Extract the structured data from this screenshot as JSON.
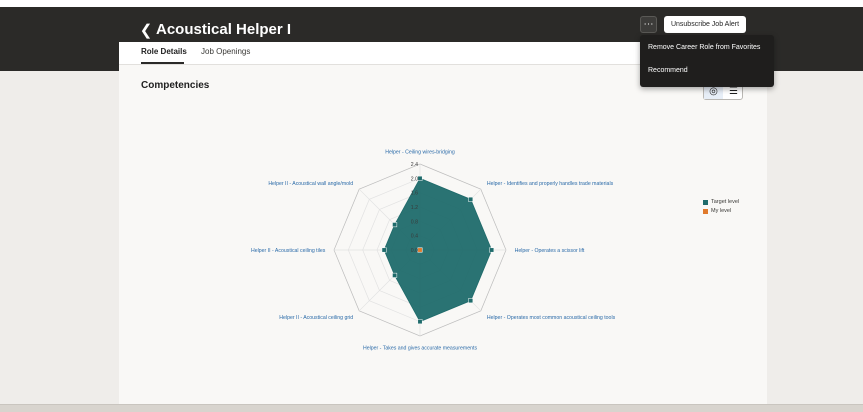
{
  "header": {
    "title": "Acoustical Helper I",
    "back_icon": "chevron-left-icon",
    "more_icon": "ellipsis-icon",
    "unsubscribe_label": "Unsubscribe Job Alert",
    "background": "#2b2a28"
  },
  "menu": {
    "items": [
      {
        "label": "Remove Career Role from Favorites"
      },
      {
        "label": "Recommend"
      }
    ]
  },
  "tabs": [
    {
      "label": "Role Details",
      "active": true
    },
    {
      "label": "Job Openings",
      "active": false
    }
  ],
  "section": {
    "title": "Competencies"
  },
  "view_toggle": {
    "selected": "radar",
    "icons": [
      "radar-chart-icon",
      "list-icon"
    ]
  },
  "chart_data": {
    "type": "radar",
    "axes": [
      "Helper - Ceiling wires-bridging",
      "Helper - Identifies and properly handles trade materials",
      "Helper - Operates a scissor lift",
      "Helper - Operates most common acoustical ceiling tools",
      "Helper - Takes and gives accurate measurements",
      "Helper II - Acoustical ceiling grid",
      "Helper II - Acoustical ceiling tiles",
      "Helper II - Acoustical wall angle/mold"
    ],
    "ticks": [
      "0.0",
      "0.4",
      "0.8",
      "1.2",
      "1.6",
      "2.0",
      "2.4"
    ],
    "range": [
      0,
      2.4
    ],
    "series": [
      {
        "name": "Target level",
        "color": "#1f6b6b",
        "values": [
          2,
          2,
          2,
          2,
          2,
          1,
          1,
          1
        ]
      },
      {
        "name": "My level",
        "color": "#e07a2c",
        "values": [
          0,
          0,
          0,
          0,
          0,
          0,
          0,
          0
        ]
      }
    ],
    "legend_position": "right"
  }
}
